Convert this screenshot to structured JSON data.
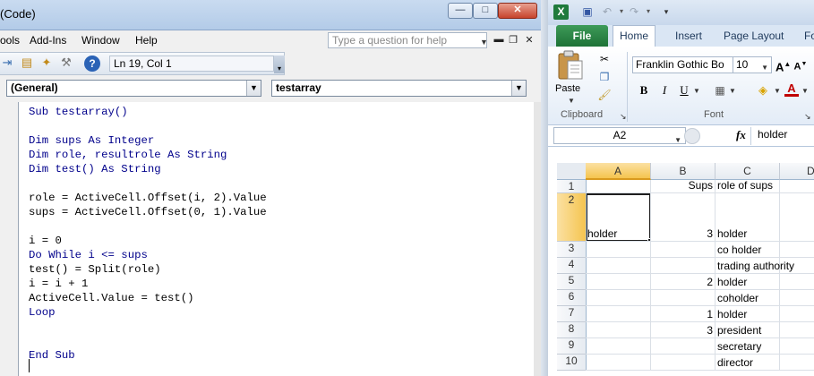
{
  "vba": {
    "title": "(Code)",
    "window_buttons": {
      "minimize": "—",
      "maximize": "□",
      "close": "✕"
    },
    "menu": [
      "ools",
      "Add-Ins",
      "Window",
      "Help"
    ],
    "help_placeholder": "Type a question for help",
    "position": "Ln 19, Col 1",
    "object_combo": "(General)",
    "procedure_combo": "testarray",
    "code_lines": [
      "Sub testarray()",
      "",
      "Dim sups As Integer",
      "Dim role, resultrole As String",
      "Dim test() As String",
      "",
      "role = ActiveCell.Offset(i, 2).Value",
      "sups = ActiveCell.Offset(0, 1).Value",
      "",
      "i = 0",
      "Do While i <= sups",
      "test() = Split(role)",
      "i = i + 1",
      "ActiveCell.Value = test()",
      "Loop",
      "",
      "",
      "End Sub"
    ]
  },
  "excel": {
    "tabs": {
      "file": "File",
      "home": "Home",
      "insert": "Insert",
      "page_layout": "Page Layout",
      "formulas": "Fo"
    },
    "clipboard": {
      "paste": "Paste",
      "group": "Clipboard"
    },
    "font": {
      "name": "Franklin Gothic Bo",
      "size": "10",
      "group": "Font"
    },
    "name_box": "A2",
    "formula_content": "holder",
    "columns": [
      "A",
      "B",
      "C",
      "D"
    ],
    "rows": [
      {
        "n": "1",
        "a": "",
        "b": "Sups",
        "c": "role of sups"
      },
      {
        "n": "2",
        "a": "holder",
        "b": "3",
        "c": "holder"
      },
      {
        "n": "3",
        "a": "",
        "b": "",
        "c": "co holder"
      },
      {
        "n": "4",
        "a": "",
        "b": "",
        "c": "trading authority"
      },
      {
        "n": "5",
        "a": "",
        "b": "2",
        "c": "holder"
      },
      {
        "n": "6",
        "a": "",
        "b": "",
        "c": "coholder"
      },
      {
        "n": "7",
        "a": "",
        "b": "1",
        "c": "holder"
      },
      {
        "n": "8",
        "a": "",
        "b": "3",
        "c": "president"
      },
      {
        "n": "9",
        "a": "",
        "b": "",
        "c": "secretary"
      },
      {
        "n": "10",
        "a": "",
        "b": "",
        "c": "director"
      }
    ]
  }
}
